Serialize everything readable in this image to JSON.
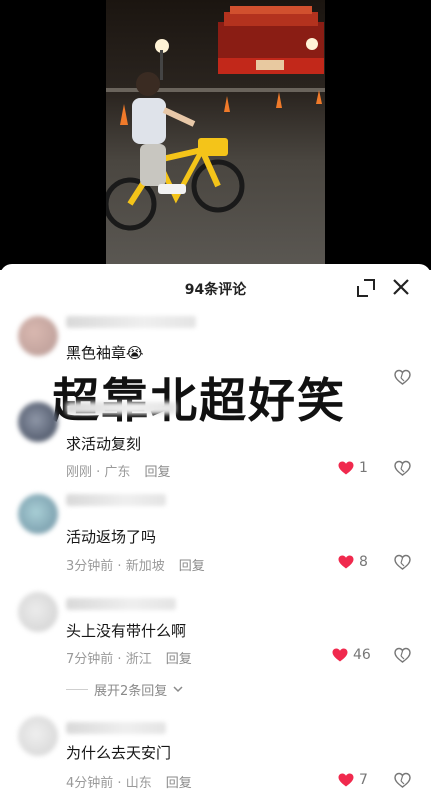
{
  "colors": {
    "accent_like": "#f0294d",
    "muted_text": "#9a9a9a",
    "sheet_bg": "#ffffff",
    "video_bg": "#000000"
  },
  "header": {
    "title": "94条评论",
    "expand_icon": "fullscreen-expand-icon",
    "close_icon": "close-x-icon"
  },
  "overlay_caption": "超靠北超好笑",
  "comments": [
    {
      "text": "黑色袖章😭",
      "time": "",
      "location": "",
      "reply_label": "",
      "likes": "",
      "liked": false
    },
    {
      "text": "求活动复刻",
      "time": "刚刚",
      "location": "广东",
      "reply_label": "回复",
      "likes": "1",
      "liked": true
    },
    {
      "text": "活动返场了吗",
      "time": "3分钟前",
      "location": "新加坡",
      "reply_label": "回复",
      "likes": "8",
      "liked": true
    },
    {
      "text": "头上没有带什么啊",
      "time": "7分钟前",
      "location": "浙江",
      "reply_label": "回复",
      "likes": "46",
      "liked": true
    },
    {
      "text": "为什么去天安门",
      "time": "4分钟前",
      "location": "山东",
      "reply_label": "回复",
      "likes": "7",
      "liked": true
    }
  ],
  "expand_replies": "展开2条回复"
}
